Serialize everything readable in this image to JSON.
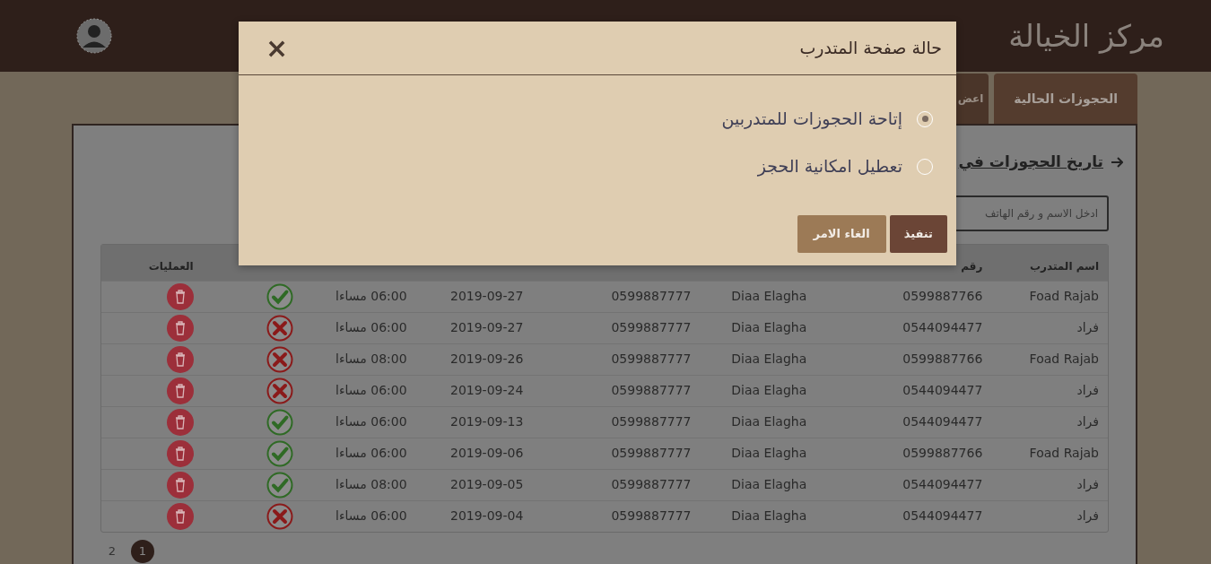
{
  "header": {
    "title": "مركز الخيالة"
  },
  "tabs": [
    {
      "label": "الحجوزات الحالية",
      "selected": true
    },
    {
      "label": "اعض",
      "selected": false
    }
  ],
  "section": {
    "title": "تاريخ الحجوزات في"
  },
  "search": {
    "placeholder": "ادخل الاسم و رقم الهاتف"
  },
  "table": {
    "columns": [
      "اسم المتدرب",
      "رقم",
      "",
      "",
      "",
      "",
      "",
      "العمليات"
    ],
    "rows": [
      {
        "name": "Foad Rajab",
        "phone": "0599887766",
        "trainer": "Diaa Elagha",
        "trainer_phone": "0599887777",
        "date": "2019-09-27",
        "time": "06:00 مساءا",
        "confirmed": true
      },
      {
        "name": "فراد",
        "phone": "0544094477",
        "trainer": "Diaa Elagha",
        "trainer_phone": "0599887777",
        "date": "2019-09-27",
        "time": "06:00 مساءا",
        "confirmed": false
      },
      {
        "name": "Foad Rajab",
        "phone": "0599887766",
        "trainer": "Diaa Elagha",
        "trainer_phone": "0599887777",
        "date": "2019-09-26",
        "time": "08:00 مساءا",
        "confirmed": false
      },
      {
        "name": "فراد",
        "phone": "0544094477",
        "trainer": "Diaa Elagha",
        "trainer_phone": "0599887777",
        "date": "2019-09-24",
        "time": "06:00 مساءا",
        "confirmed": false
      },
      {
        "name": "فراد",
        "phone": "0544094477",
        "trainer": "Diaa Elagha",
        "trainer_phone": "0599887777",
        "date": "2019-09-13",
        "time": "06:00 مساءا",
        "confirmed": true
      },
      {
        "name": "Foad Rajab",
        "phone": "0599887766",
        "trainer": "Diaa Elagha",
        "trainer_phone": "0599887777",
        "date": "2019-09-06",
        "time": "06:00 مساءا",
        "confirmed": true
      },
      {
        "name": "فراد",
        "phone": "0544094477",
        "trainer": "Diaa Elagha",
        "trainer_phone": "0599887777",
        "date": "2019-09-05",
        "time": "08:00 مساءا",
        "confirmed": true
      },
      {
        "name": "فراد",
        "phone": "0544094477",
        "trainer": "Diaa Elagha",
        "trainer_phone": "0599887777",
        "date": "2019-09-04",
        "time": "06:00 مساءا",
        "confirmed": false
      }
    ]
  },
  "pagination": [
    {
      "label": "1",
      "selected": true
    },
    {
      "label": "2",
      "selected": false
    }
  ],
  "modal": {
    "title": "حالة صفحة المتدرب",
    "close": "×",
    "options": [
      {
        "label": "إتاحة الحجوزات للمتدربين",
        "selected": true
      },
      {
        "label": "تعطيل امكانية الحجز",
        "selected": false
      }
    ],
    "buttons": [
      {
        "label": "تنفيذ",
        "kind": "primary"
      },
      {
        "label": "الغاء الامر",
        "kind": "secondary"
      }
    ]
  }
}
